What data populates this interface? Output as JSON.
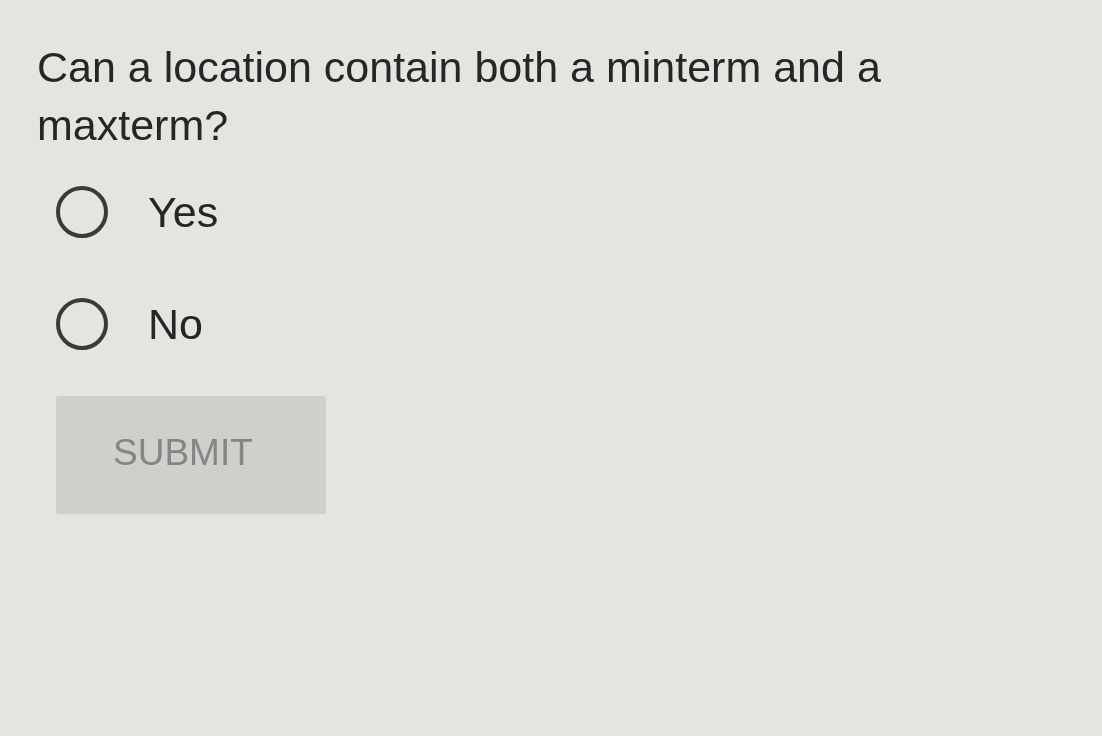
{
  "question": "Can a location contain both a minterm and a maxterm?",
  "options": [
    {
      "label": "Yes",
      "selected": false
    },
    {
      "label": "No",
      "selected": false
    }
  ],
  "submit": {
    "label": "SUBMIT",
    "disabled": true
  }
}
